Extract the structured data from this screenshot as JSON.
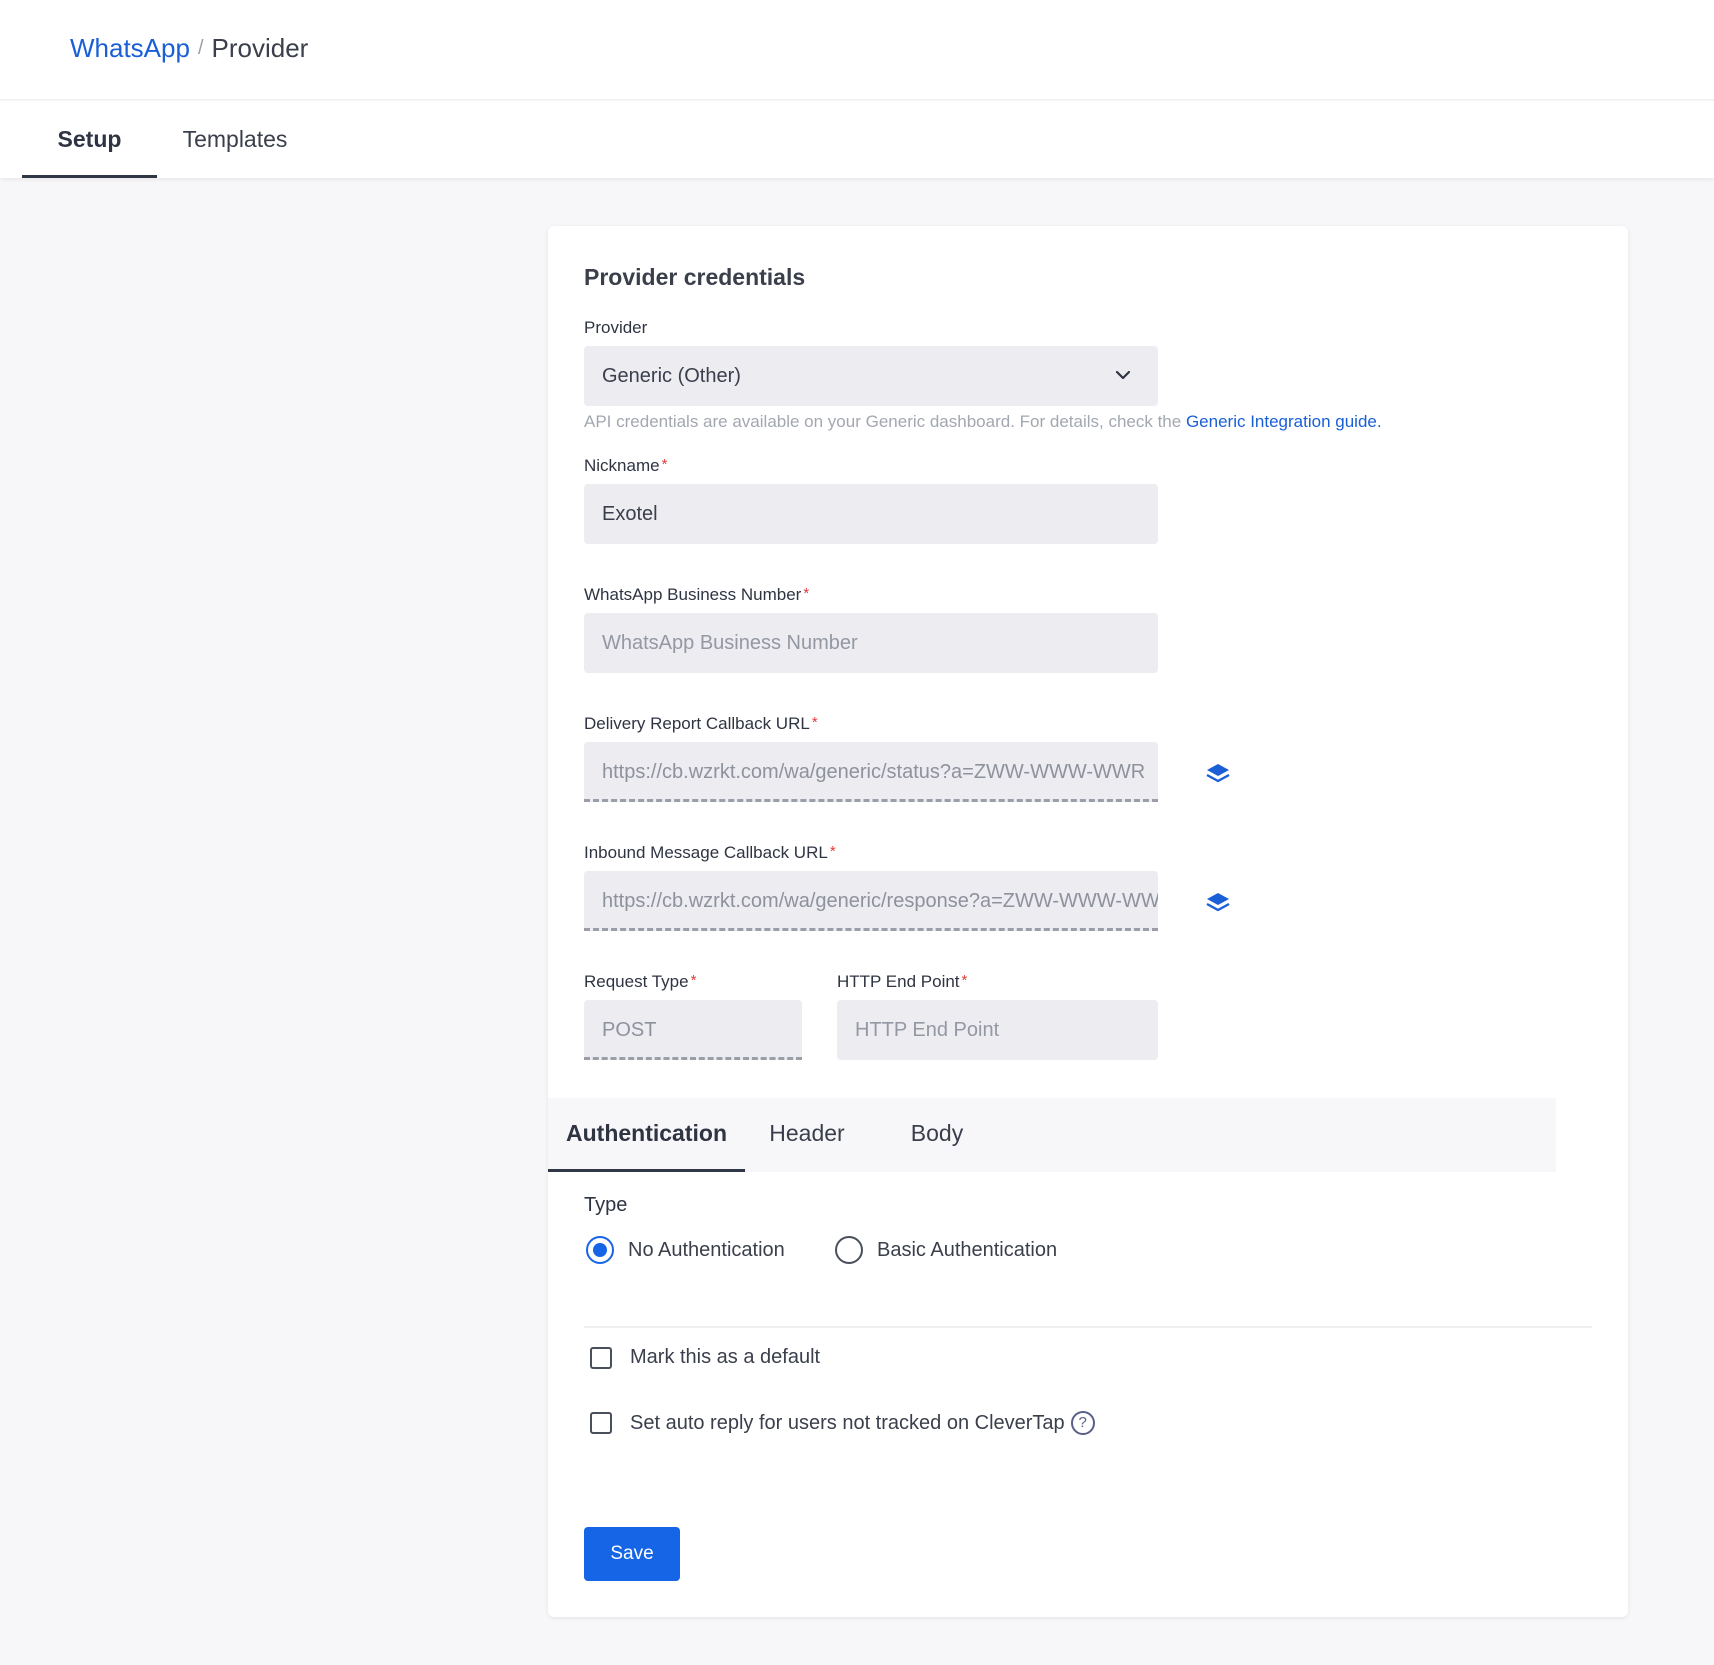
{
  "breadcrumb": {
    "parent": "WhatsApp",
    "separator": "/",
    "current": "Provider"
  },
  "tabs": {
    "setup": "Setup",
    "templates": "Templates"
  },
  "card": {
    "title": "Provider credentials",
    "provider": {
      "label": "Provider",
      "value": "Generic (Other)"
    },
    "helper": {
      "text": "API credentials are available on your Generic dashboard. For details, check the",
      "link": "Generic Integration guide."
    },
    "nickname": {
      "label": "Nickname",
      "value": "Exotel"
    },
    "business_number": {
      "label": "WhatsApp Business Number",
      "placeholder": "WhatsApp Business Number"
    },
    "delivery_url": {
      "label": "Delivery Report Callback URL",
      "value": "https://cb.wzrkt.com/wa/generic/status?a=ZWW-WWW-WWR"
    },
    "inbound_url": {
      "label": "Inbound Message Callback URL",
      "value": "https://cb.wzrkt.com/wa/generic/response?a=ZWW-WWW-WWR"
    },
    "request_type": {
      "label": "Request Type",
      "value": "POST"
    },
    "http_endpoint": {
      "label": "HTTP End Point",
      "placeholder": "HTTP End Point"
    },
    "required_mark": "*"
  },
  "subtabs": {
    "auth": "Authentication",
    "header": "Header",
    "body": "Body"
  },
  "auth": {
    "type_label": "Type",
    "options": [
      "No Authentication",
      "Basic Authentication"
    ],
    "selected": "No Authentication"
  },
  "checks": {
    "default": "Mark this as a default",
    "auto_reply": "Set auto reply for users not tracked on CleverTap",
    "help": "?"
  },
  "save_label": "Save",
  "colors": {
    "accent": "#1565e6",
    "link": "#1a5fd6",
    "required": "#e23b3b"
  }
}
